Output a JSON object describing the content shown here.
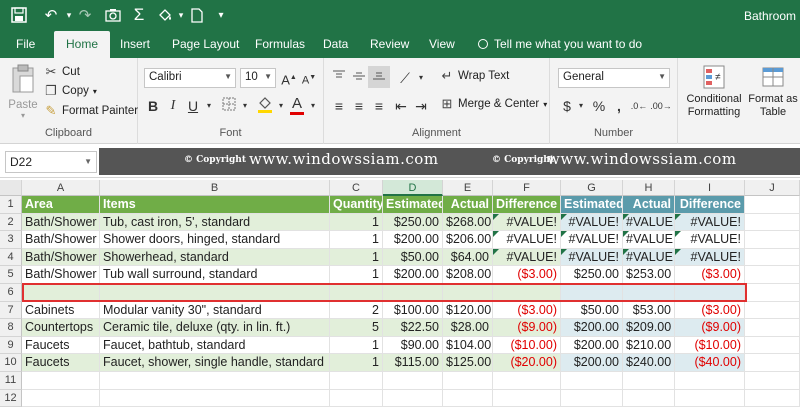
{
  "window": {
    "title": "Bathroom r",
    "accent": "#217346"
  },
  "quick_access": {
    "save_icon": "save-icon",
    "undo_icon": "undo-icon",
    "redo_icon": "redo-icon",
    "camera_icon": "camera-icon",
    "autosum_icon": "sigma-icon",
    "fill_icon": "paint-bucket-icon",
    "new_icon": "new-document-icon",
    "customize_icon": "customize-chevron-icon"
  },
  "tabs": [
    {
      "label": "File"
    },
    {
      "label": "Home"
    },
    {
      "label": "Insert"
    },
    {
      "label": "Page Layout"
    },
    {
      "label": "Formulas"
    },
    {
      "label": "Data"
    },
    {
      "label": "Review"
    },
    {
      "label": "View"
    }
  ],
  "tell_me": "Tell me what you want to do",
  "ribbon": {
    "clipboard": {
      "label": "Clipboard",
      "paste": "Paste",
      "cut": "Cut",
      "copy": "Copy",
      "format_painter": "Format Painter"
    },
    "font": {
      "label": "Font",
      "family": "Calibri",
      "size": "10"
    },
    "alignment": {
      "label": "Alignment",
      "wrap_text": "Wrap Text",
      "merge_center": "Merge & Center"
    },
    "number": {
      "label": "Number",
      "format": "General"
    },
    "styles": {
      "conditional_formatting": [
        "Conditional",
        "Formatting"
      ],
      "format_as_table": [
        "Format as",
        "Table"
      ]
    }
  },
  "name_box": "D22",
  "watermark": {
    "copyright_1": "© Copyright",
    "site_1": "www.windowssiam.com",
    "copyright_2": "© Copyright",
    "site_2": "www.windowssiam.com"
  },
  "columns": [
    "A",
    "B",
    "C",
    "D",
    "E",
    "F",
    "G",
    "H",
    "I",
    "J"
  ],
  "selected_column": "D",
  "rows": [
    [
      "Area",
      "Items",
      "Quantity",
      "Estimated",
      "Actual",
      "Difference",
      "Estimated",
      "Actual",
      "Difference",
      ""
    ],
    [
      "Bath/Shower",
      "Tub, cast iron, 5', standard",
      "1",
      "$250.00",
      "$268.00",
      "#VALUE!",
      "#VALUE!",
      "#VALUE!",
      "#VALUE!",
      ""
    ],
    [
      "Bath/Shower",
      "Shower doors, hinged, standard",
      "1",
      "$200.00",
      "$206.00",
      "#VALUE!",
      "#VALUE!",
      "#VALUE!",
      "#VALUE!",
      ""
    ],
    [
      "Bath/Shower",
      "Showerhead, standard",
      "1",
      "$50.00",
      "$64.00",
      "#VALUE!",
      "#VALUE!",
      "#VALUE!",
      "#VALUE!",
      ""
    ],
    [
      "Bath/Shower",
      "Tub wall surround, standard",
      "1",
      "$200.00",
      "$208.00",
      "($3.00)",
      "$250.00",
      "$253.00",
      "($3.00)",
      ""
    ],
    [
      "",
      "",
      "",
      "",
      "",
      "",
      "",
      "",
      "",
      ""
    ],
    [
      "Cabinets",
      "Modular vanity 30\", standard",
      "2",
      "$100.00",
      "$120.00",
      "($3.00)",
      "$50.00",
      "$53.00",
      "($3.00)",
      ""
    ],
    [
      "Countertops",
      "Ceramic tile, deluxe (qty. in lin. ft.)",
      "5",
      "$22.50",
      "$28.00",
      "($9.00)",
      "$200.00",
      "$209.00",
      "($9.00)",
      ""
    ],
    [
      "Faucets",
      "Faucet, bathtub, standard",
      "1",
      "$90.00",
      "$104.00",
      "($10.00)",
      "$200.00",
      "$210.00",
      "($10.00)",
      ""
    ],
    [
      "Faucets",
      "Faucet, shower, single handle, standard",
      "1",
      "$115.00",
      "$125.00",
      "($20.00)",
      "$200.00",
      "$240.00",
      "($40.00)",
      ""
    ],
    [
      "",
      "",
      "",
      "",
      "",
      "",
      "",
      "",
      "",
      ""
    ],
    [
      "",
      "",
      "",
      "",
      "",
      "",
      "",
      "",
      "",
      ""
    ]
  ],
  "row_numbers": [
    "1",
    "2",
    "3",
    "4",
    "5",
    "6",
    "7",
    "8",
    "9",
    "10",
    "11",
    "12"
  ],
  "highlighted_row": "6",
  "colors": {
    "header_green": "#70ad47",
    "header_teal": "#5b9bab",
    "band_green": "#e2efda",
    "band_teal": "#ddebf0",
    "negative": "#e00000",
    "highlight_box": "#e03030"
  }
}
